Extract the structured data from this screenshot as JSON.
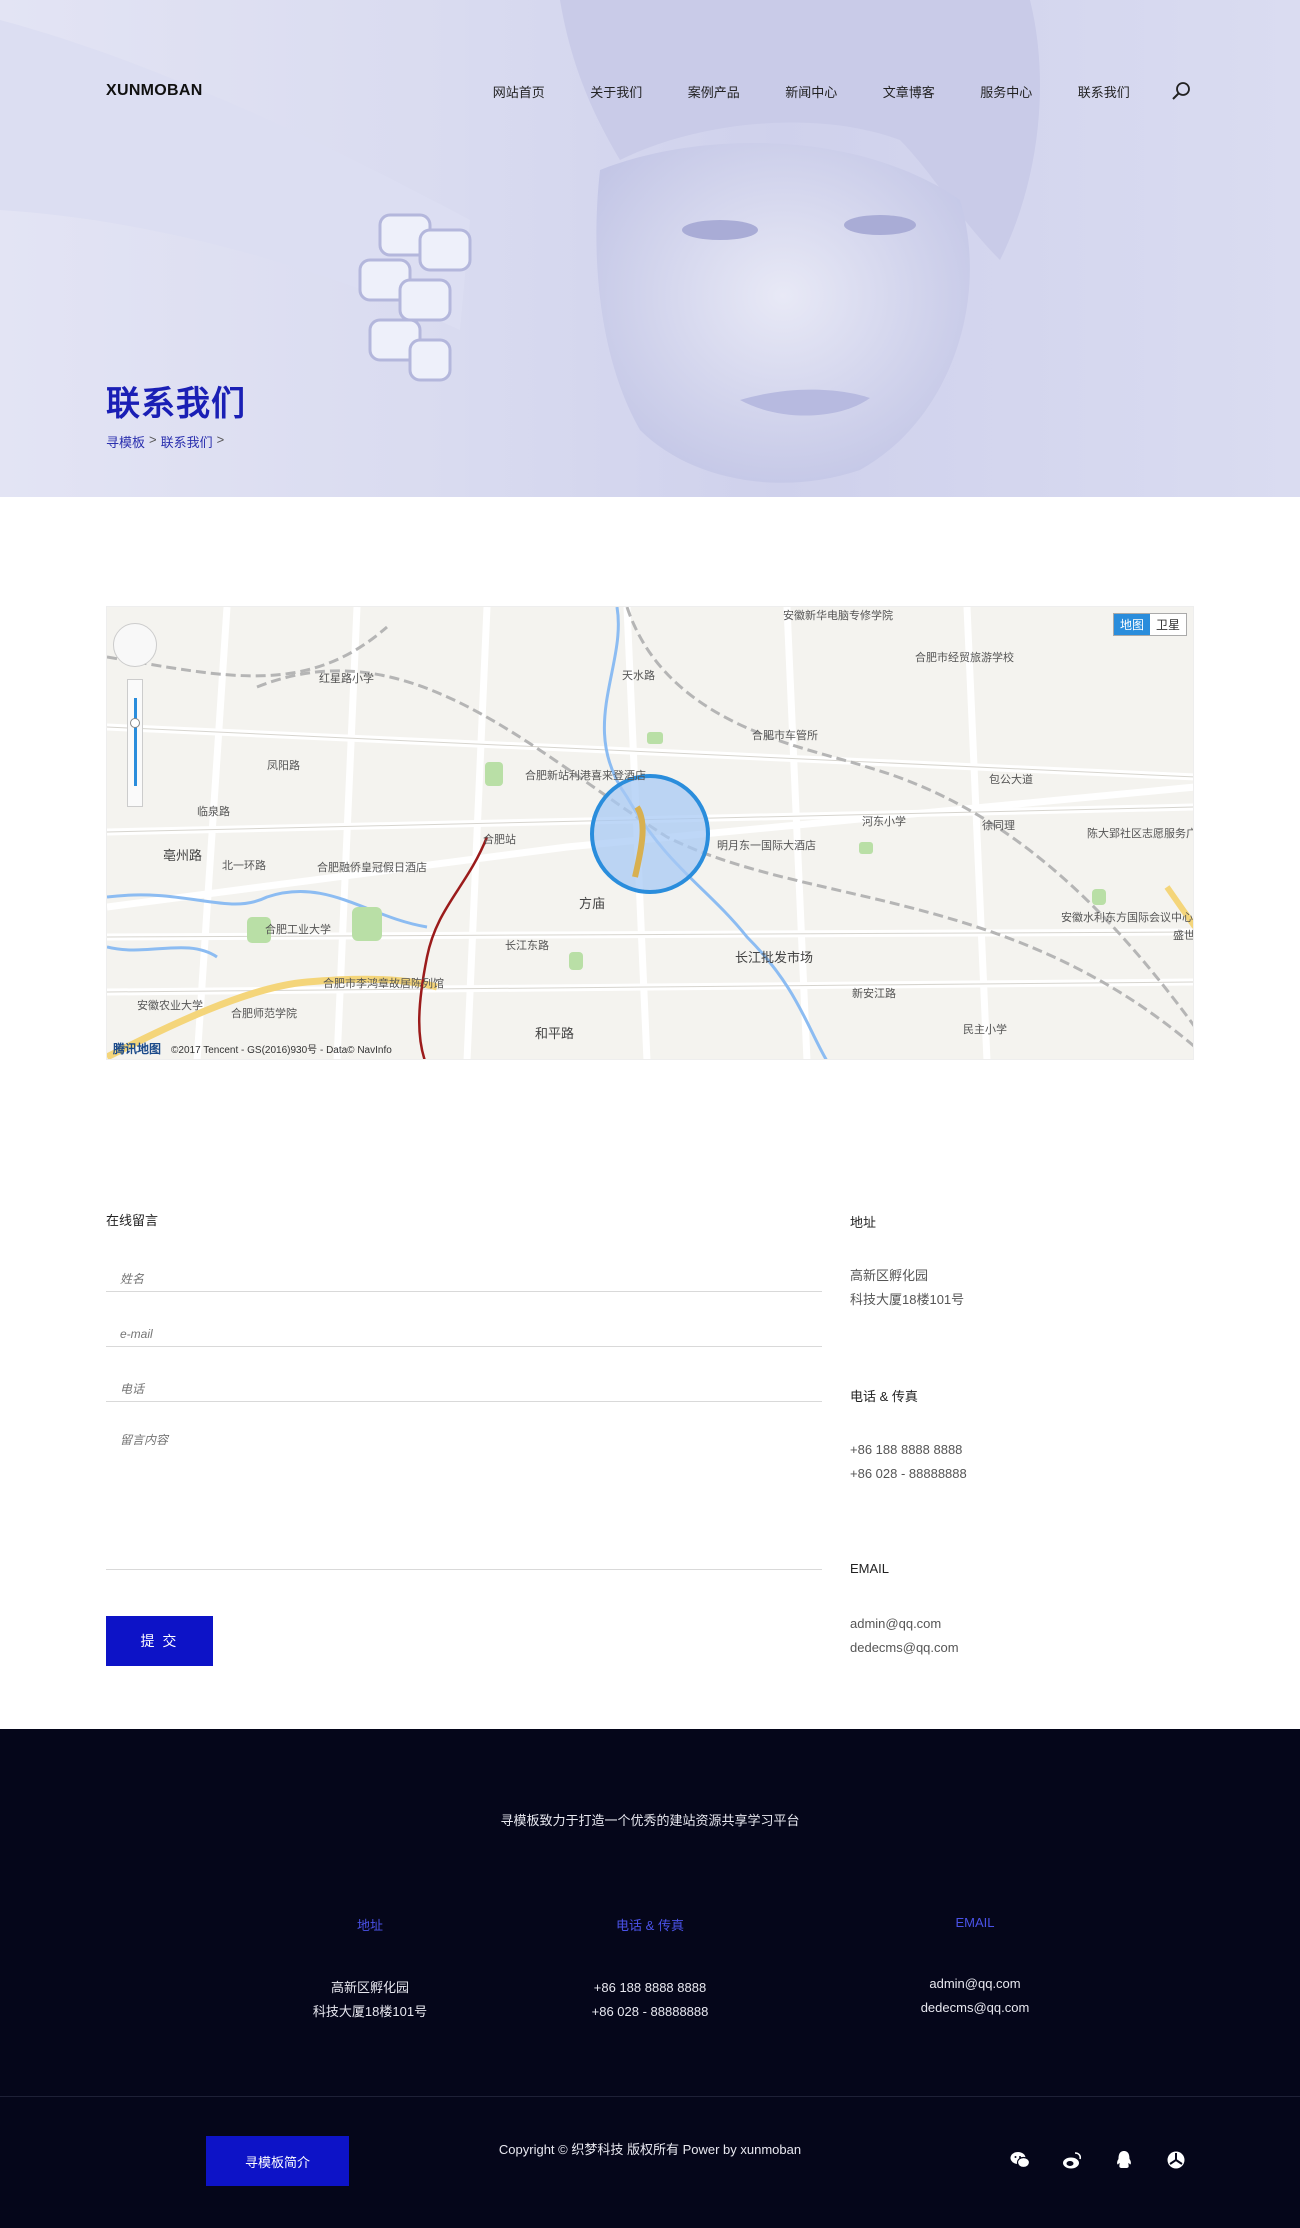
{
  "header": {
    "logo": "XUNMOBAN",
    "nav": [
      "网站首页",
      "关于我们",
      "案例产品",
      "新闻中心",
      "文章博客",
      "服务中心",
      "联系我们"
    ]
  },
  "hero": {
    "title": "联系我们",
    "breadcrumb": [
      "寻模板",
      ">",
      "联系我们",
      ">"
    ]
  },
  "map": {
    "toggle": [
      "地图",
      "卫星"
    ],
    "brand": "腾讯地图",
    "credit": "©2017 Tencent - GS(2016)930号 - Data© NavInfo",
    "labels": [
      "安徽新华电脑专修学院",
      "合肥市经贸旅游学校",
      "红星路小学",
      "合肥市车管所",
      "合肥新站利港喜来登酒店",
      "明月东一国际大酒店",
      "河东小学",
      "徐同理",
      "陈大郢社区志愿服务广场",
      "亳州路",
      "合肥融侨皇冠假日酒店",
      "方庙",
      "合肥站",
      "合肥工业大学",
      "合肥市李鸿章故居陈列馆",
      "长江批发市场",
      "安徽水利东方国际会议中心",
      "安徽农业大学",
      "合肥师范学院",
      "民主小学",
      "和平路",
      "长江东路",
      "新安江路",
      "天水路",
      "临泉路",
      "北一环路",
      "包公大道",
      "凤阳路",
      "盛世"
    ]
  },
  "form": {
    "title": "在线留言",
    "name_placeholder": "姓名",
    "email_placeholder": "e-mail",
    "phone_placeholder": "电话",
    "message_placeholder": "留言内容",
    "submit": "提 交"
  },
  "contact": {
    "address_title": "地址",
    "address_lines": [
      "高新区孵化园",
      "科技大厦18楼101号"
    ],
    "phone_title": "电话 & 传真",
    "phone_lines": [
      "+86 188 8888 8888",
      "+86 028 - 88888888"
    ],
    "email_title": "EMAIL",
    "email_lines": [
      "admin@qq.com",
      "dedecms@qq.com"
    ]
  },
  "footer": {
    "slogan": "寻模板致力于打造一个优秀的建站资源共享学习平台",
    "address_title": "地址",
    "address_lines": [
      "高新区孵化园",
      "科技大厦18楼101号"
    ],
    "phone_title": "电话 & 传真",
    "phone_lines": [
      "+86 188 8888 8888",
      "+86 028 - 88888888"
    ],
    "email_title": "EMAIL",
    "email_lines": [
      "admin@qq.com",
      "dedecms@qq.com"
    ],
    "intro_button": "寻模板简介",
    "copyright": "Copyright © 织梦科技 版权所有 Power by xunmoban",
    "social_icons": [
      "wechat-icon",
      "weibo-icon",
      "qq-icon",
      "share-icon"
    ]
  },
  "colors": {
    "brand_blue": "#0d13c7",
    "title_blue": "#1a1fb5",
    "footer_bg": "#05061a",
    "footer_heading": "#4a52e8",
    "map_accent": "#2a8ddc"
  }
}
